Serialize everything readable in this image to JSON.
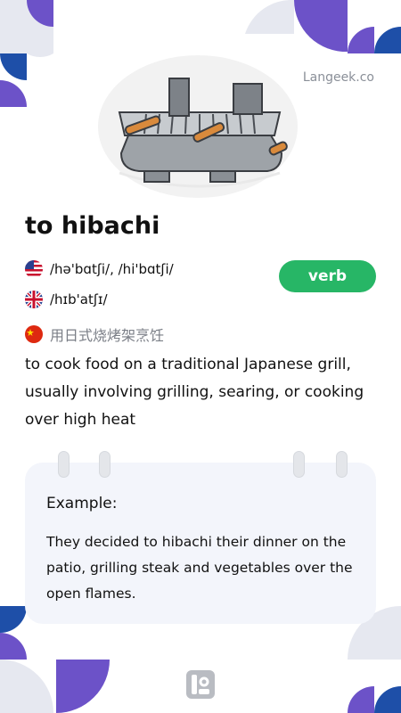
{
  "site": {
    "name": "Langeek.co"
  },
  "word": "to hibachi",
  "pronunciations": [
    {
      "flag_icon": "us-flag-icon",
      "ipa": "/hə'bɑtʃi/, /hi'bɑtʃi/"
    },
    {
      "flag_icon": "uk-flag-icon",
      "ipa": "/hɪb'atʃɪ/"
    }
  ],
  "translation": {
    "flag_icon": "china-flag-icon",
    "text": "用日式烧烤架烹饪"
  },
  "part_of_speech": "verb",
  "definition": "to cook food on a traditional Japanese grill, usually involving grilling, searing, or cooking over high heat",
  "example": {
    "label": "Example:",
    "text": "They decided to hibachi their dinner on the patio, grilling steak and vegetables over the open flames."
  },
  "illustration": {
    "icon": "hibachi-grill-illustration"
  },
  "colors": {
    "purple": "#6c52c8",
    "blue": "#1e4fa8",
    "light": "#e6e8f0",
    "pos_badge": "#27b666",
    "card_bg": "#f3f5fb"
  }
}
